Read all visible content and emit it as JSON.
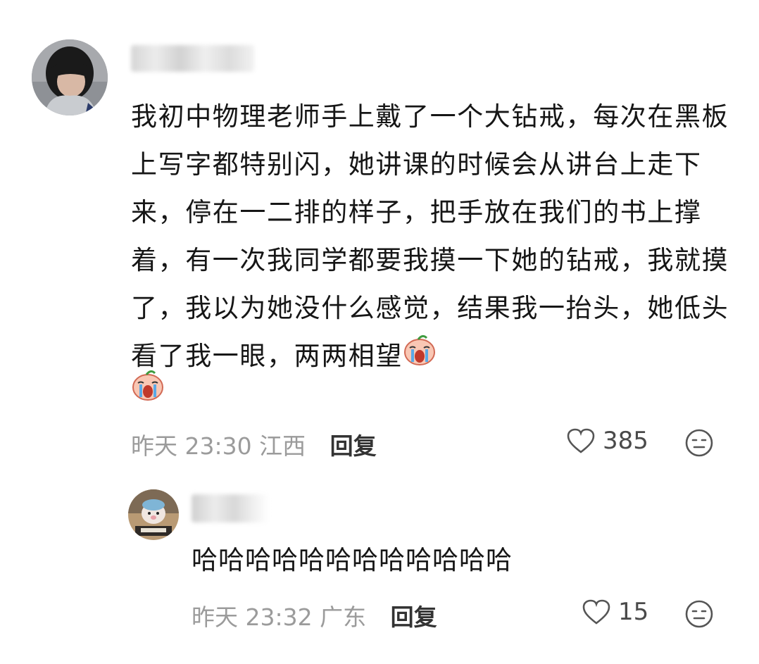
{
  "comments": [
    {
      "text": "我初中物理老师手上戴了一个大钻戒，每次在黑板上写字都特别闪，她讲课的时候会从讲台上走下来，停在一二排的样子，把手放在我们的书上撑着，有一次我同学都要我摸一下她的钻戒，我就摸了，我以为她没什么感觉，结果我一抬头，她低头看了我一眼，两两相望",
      "time": "昨天 23:30",
      "location": "江西",
      "reply_label": "回复",
      "likes": "385",
      "sticker_icon": "crying-peach-sticker"
    },
    {
      "text": "哈哈哈哈哈哈哈哈哈哈哈哈",
      "time": "昨天 23:32",
      "location": "广东",
      "reply_label": "回复",
      "likes": "15"
    }
  ],
  "icons": {
    "like": "heart-outline-icon",
    "emoji": "neutral-face-icon"
  }
}
